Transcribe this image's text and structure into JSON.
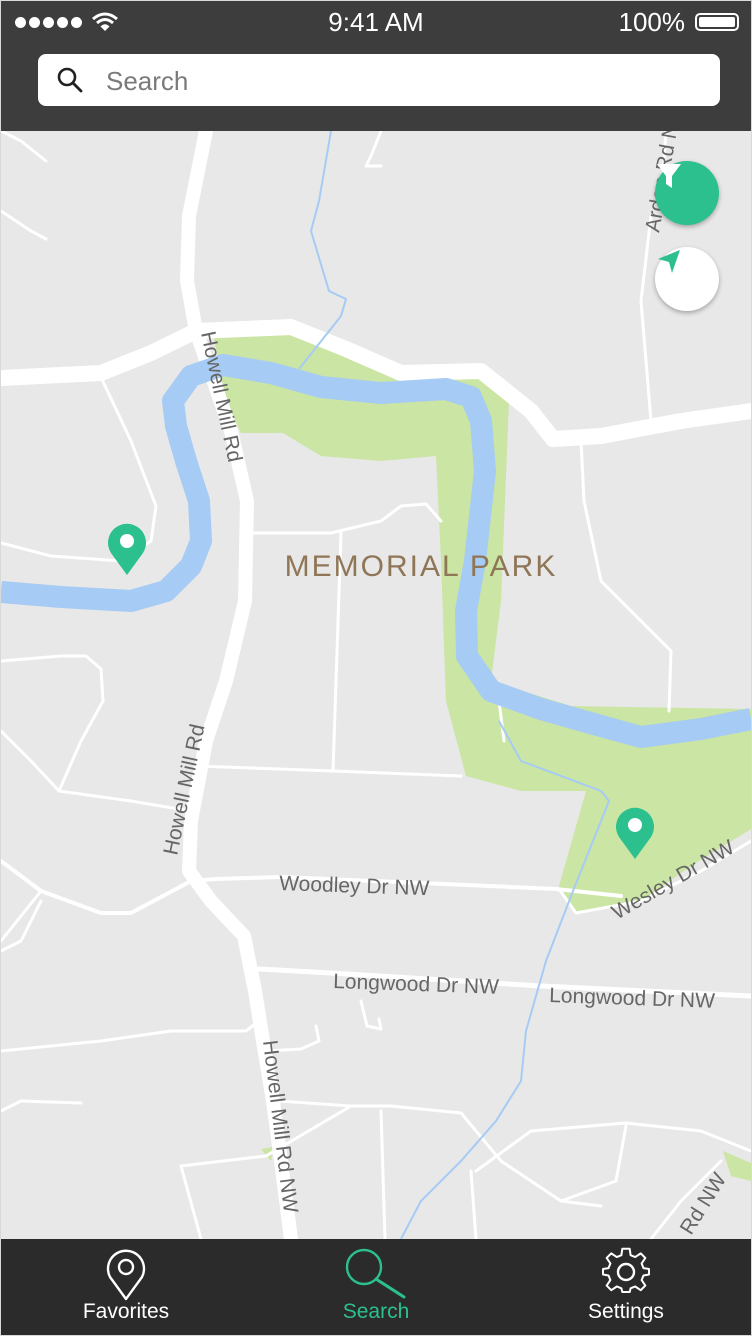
{
  "status_bar": {
    "time": "9:41 AM",
    "battery": "100%"
  },
  "search": {
    "placeholder": "Search",
    "value": ""
  },
  "map": {
    "park_label": "MEMORIAL PARK",
    "streets": {
      "howell_mill_1": "Howell Mill Rd",
      "howell_mill_2": "Howell Mill Rd",
      "howell_mill_nw": "Howell Mill Rd NW",
      "arden": "Arden Rd N",
      "woodley": "Woodley Dr NW",
      "longwood_1": "Longwood Dr NW",
      "longwood_2": "Longwood Dr NW",
      "wesley": "Wesley Dr NW",
      "rd_nw": "Rd NW"
    },
    "colors": {
      "water": "#a6cbf4",
      "park": "#cbe5a4",
      "land": "#e8e8e8",
      "road": "#ffffff",
      "pin": "#2cc08f"
    }
  },
  "map_controls": {
    "filter_icon": "filter-icon",
    "locate_icon": "navigation-arrow-icon"
  },
  "tabs": [
    {
      "label": "Favorites",
      "icon": "location-pin-icon",
      "active": false
    },
    {
      "label": "Search",
      "icon": "search-icon",
      "active": true
    },
    {
      "label": "Settings",
      "icon": "gear-icon",
      "active": false
    }
  ],
  "accent_color": "#2cc08f",
  "header_color": "#3d3d3d",
  "tabbar_color": "#2b2b2b"
}
